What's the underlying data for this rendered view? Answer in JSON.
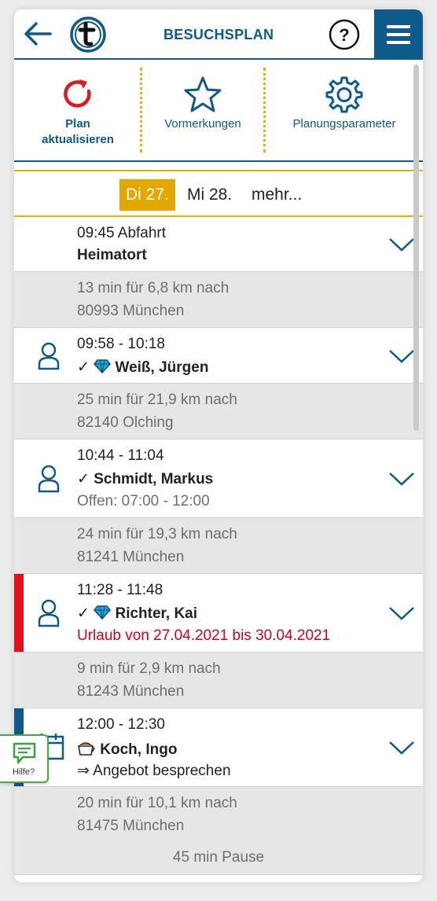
{
  "header": {
    "title": "BESUCHSPLAN"
  },
  "toolbar": [
    {
      "label": "Plan aktualisieren",
      "icon": "refresh-icon"
    },
    {
      "label": "Vormerkungen",
      "icon": "star-icon"
    },
    {
      "label": "Planungsparameter",
      "icon": "gear-icon"
    }
  ],
  "dates": {
    "active": "Di 27.",
    "next": "Mi 28.",
    "more": "mehr..."
  },
  "items": {
    "start": {
      "time": "09:45 Abfahrt",
      "name": "Heimatort"
    },
    "travel1": {
      "line1": "13 min für 6,8 km nach",
      "line2": "80993 München"
    },
    "visit1": {
      "time": "09:58 - 10:18",
      "check": "✓",
      "name": "Weiß, Jürgen"
    },
    "travel2": {
      "line1": "25 min für 21,9 km nach",
      "line2": "82140 Olching"
    },
    "visit2": {
      "time": "10:44 - 11:04",
      "check": "✓",
      "name": "Schmidt, Markus",
      "note": "Offen: 07:00 - 12:00"
    },
    "travel3": {
      "line1": "24 min für 19,3 km nach",
      "line2": "81241 München"
    },
    "visit3": {
      "time": "11:28 - 11:48",
      "check": "✓",
      "name": "Richter, Kai",
      "note": "Urlaub von 27.04.2021 bis 30.04.2021"
    },
    "travel4": {
      "line1": "9 min für 2,9 km nach",
      "line2": "81243 München"
    },
    "visit4": {
      "time": "12:00 - 12:30",
      "name": "Koch, Ingo",
      "note": "⇒ Angebot besprechen"
    },
    "travel5": {
      "line1": "20 min für 10,1 km nach",
      "line2": "81475 München"
    },
    "pause": "45 min Pause"
  },
  "help_widget": {
    "label": "Hilfe?"
  },
  "colors": {
    "primary": "#0e5a8a",
    "accent": "#e3a800",
    "alert": "#d0021b",
    "help": "#4aa84a"
  }
}
